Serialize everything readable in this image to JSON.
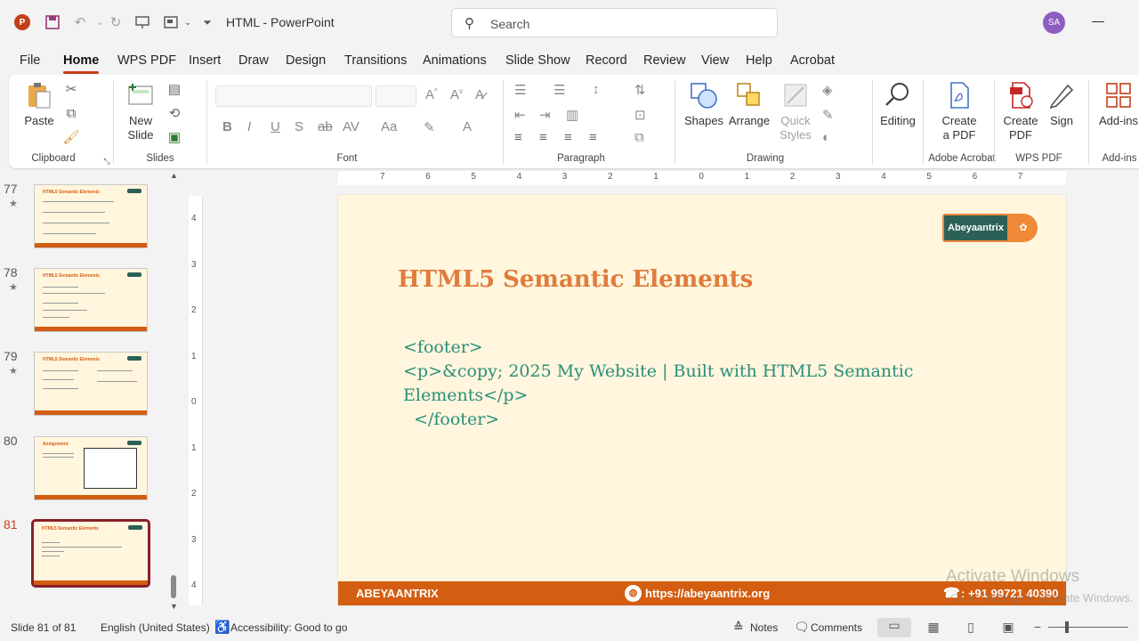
{
  "titlebar": {
    "document": "HTML",
    "app": "PowerPoint",
    "title_text": "HTML  -  PowerPoint",
    "search_placeholder": "Search",
    "user_initials": "SA"
  },
  "tabs": [
    "File",
    "Home",
    "WPS PDF",
    "Insert",
    "Draw",
    "Design",
    "Transitions",
    "Animations",
    "Slide Show",
    "Record",
    "Review",
    "View",
    "Help",
    "Acrobat"
  ],
  "active_tab": "Home",
  "ribbon": {
    "clipboard": {
      "paste": "Paste",
      "group": "Clipboard"
    },
    "slides": {
      "new_slide_1": "New",
      "new_slide_2": "Slide",
      "group": "Slides"
    },
    "font": {
      "group": "Font"
    },
    "paragraph": {
      "group": "Paragraph"
    },
    "drawing": {
      "shapes": "Shapes",
      "arrange": "Arrange",
      "quick_1": "Quick",
      "quick_2": "Styles",
      "group": "Drawing"
    },
    "editing": {
      "label": "Editing"
    },
    "adobe": {
      "create_1": "Create",
      "create_2": "a PDF",
      "group": "Adobe Acrobat"
    },
    "wps": {
      "create_1": "Create",
      "create_2": "PDF",
      "sign": "Sign",
      "group": "WPS PDF"
    },
    "addins": {
      "label": "Add-ins",
      "group": "Add-ins"
    }
  },
  "thumbnails": [
    {
      "num": "77",
      "title": "HTML5 Semantic Elements"
    },
    {
      "num": "78",
      "title": "HTML5 Semantic Elements"
    },
    {
      "num": "79",
      "title": "HTML5 Semantic Elements"
    },
    {
      "num": "80",
      "title": "Assignment"
    },
    {
      "num": "81",
      "title": "HTML5 Semantic Elements"
    }
  ],
  "ruler_h": [
    "7",
    "6",
    "5",
    "4",
    "3",
    "2",
    "1",
    "0",
    "1",
    "2",
    "3",
    "4",
    "5",
    "6",
    "7"
  ],
  "ruler_v": [
    "4",
    "3",
    "2",
    "1",
    "0",
    "1",
    "2",
    "3",
    "4"
  ],
  "slide": {
    "logo_text": "Abeyaantrix",
    "title": "HTML5 Semantic Elements",
    "code_lines": [
      "<footer>",
      "<p>&copy; 2025 My Website | Built with HTML5 Semantic",
      "Elements</p>",
      "  </footer>"
    ],
    "footer_brand": "ABEYAANTRIX",
    "footer_url": "https://abeyaantrix.org",
    "footer_phone": ": +91 99721 40390"
  },
  "watermark": {
    "line1": "Activate Windows",
    "line2": "Go to Settings to activate Windows."
  },
  "status": {
    "slide_info": "Slide 81 of 81",
    "language": "English (United States)",
    "accessibility": "Accessibility: Good to go",
    "notes": "Notes",
    "comments": "Comments"
  },
  "colors": {
    "accent": "#c43e1c",
    "slide_bg": "#fff6dd",
    "title": "#e07b3c",
    "code": "#2a8e7a",
    "footer": "#d35d10",
    "logo": "#2d6158"
  }
}
